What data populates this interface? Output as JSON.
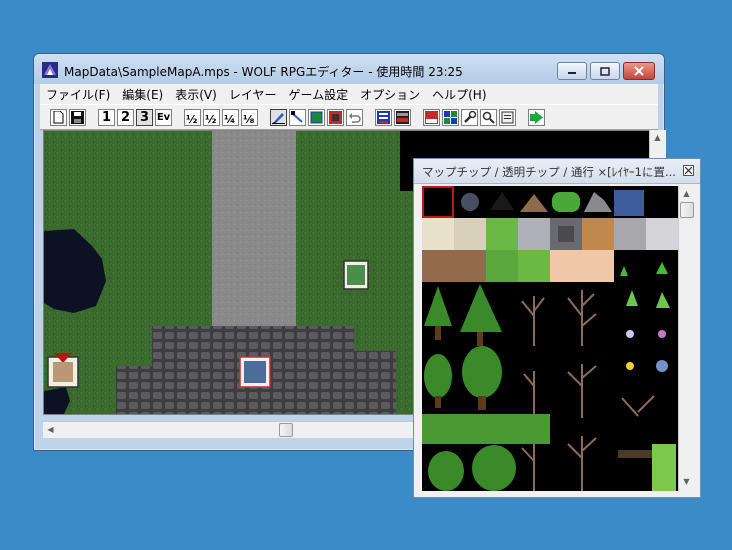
{
  "window": {
    "title": "MapData\\SampleMapA.mps - WOLF RPGエディター - 使用時間 23:25"
  },
  "menubar": {
    "items": [
      {
        "label": "ファイル(F)"
      },
      {
        "label": "編集(E)"
      },
      {
        "label": "表示(V)"
      },
      {
        "label": "レイヤー"
      },
      {
        "label": "ゲーム設定"
      },
      {
        "label": "オプション"
      },
      {
        "label": "ヘルプ(H)"
      }
    ]
  },
  "toolbar": {
    "layer1": "1",
    "layer2": "2",
    "layer3": "3",
    "event_layer": "Ev"
  },
  "palette": {
    "title": "マップチップ / 透明チップ / 通行 ×[ﾚｲﾔｰ1に置..."
  },
  "colors": {
    "desktop": "#3a8bc8",
    "grass": "#3b6a2e",
    "stone_path": "#8a8a8a",
    "cobble": "#5a5a5e",
    "water": "#0c1224"
  }
}
